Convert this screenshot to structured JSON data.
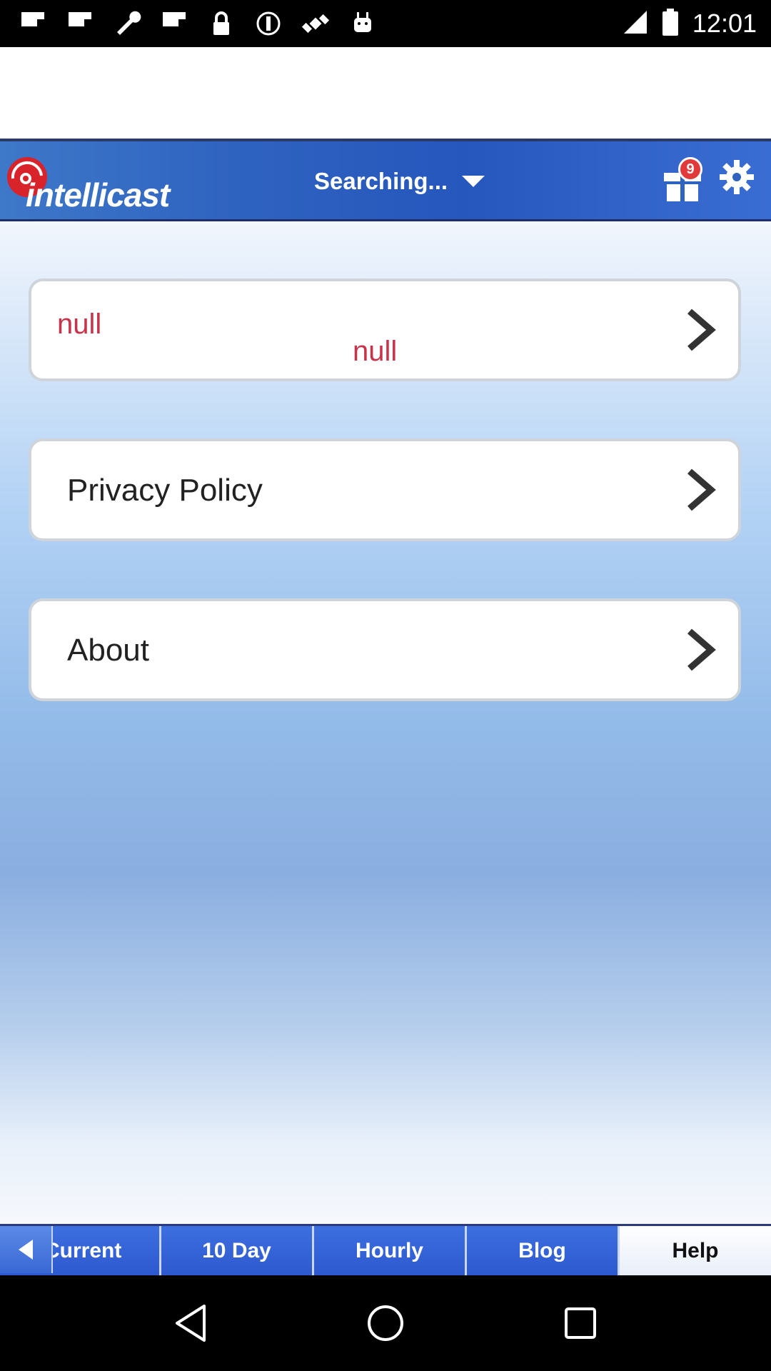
{
  "status_bar": {
    "time": "12:01",
    "icons": [
      "flipboard-icon",
      "flipboard-icon",
      "wrench-icon",
      "flipboard-icon",
      "lock-icon",
      "circle-info-icon",
      "satellite-icon",
      "android-icon"
    ]
  },
  "header": {
    "logo_text": "intellicast",
    "location_label": "Searching...",
    "gift_badge": "9",
    "colors": {
      "header_blue": "#2f63c0",
      "accent_red": "#c8334a"
    }
  },
  "menu": {
    "items": [
      {
        "id": "location",
        "primary": "null",
        "secondary": "null"
      },
      {
        "id": "privacy",
        "label": "Privacy Policy"
      },
      {
        "id": "about",
        "label": "About"
      }
    ]
  },
  "tabs": {
    "items": [
      {
        "label": "Current"
      },
      {
        "label": "10 Day"
      },
      {
        "label": "Hourly"
      },
      {
        "label": "Blog"
      },
      {
        "label": "Help",
        "active": true
      }
    ]
  },
  "nav": {
    "buttons": [
      "back-icon",
      "home-icon",
      "recents-icon"
    ]
  }
}
